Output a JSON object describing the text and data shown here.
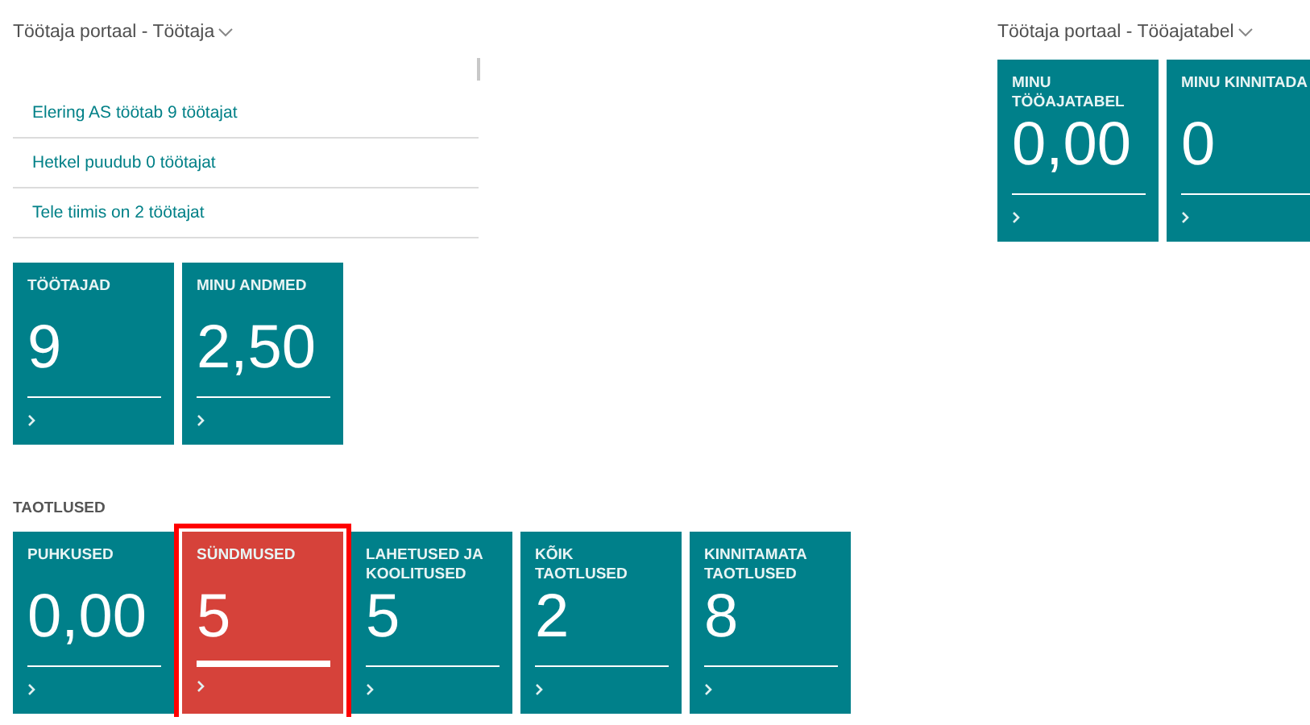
{
  "left_panel": {
    "title": "Töötaja portaal - Töötaja",
    "links": [
      "Elering AS töötab 9 töötajat",
      "Hetkel puudub 0 töötajat",
      "Tele tiimis on 2 töötajat"
    ],
    "tiles": [
      {
        "label": "TÖÖTAJAD",
        "value": "9",
        "selected": false
      },
      {
        "label": "MINU ANDMED",
        "value": "2,50",
        "selected": false
      }
    ],
    "section": {
      "title": "TAOTLUSED",
      "tiles": [
        {
          "label": "PUHKUSED",
          "value": "0,00",
          "selected": false
        },
        {
          "label": "SÜNDMUSED",
          "value": "5",
          "selected": true
        },
        {
          "label": "LAHETUSED JA KOOLITUSED",
          "value": "5",
          "selected": false
        },
        {
          "label": "KÕIK TAOTLUSED",
          "value": "2",
          "selected": false
        },
        {
          "label": "KINNITAMATA TAOTLUSED",
          "value": "8",
          "selected": false
        }
      ]
    }
  },
  "right_panel": {
    "title": "Töötaja portaal - Tööajatabel",
    "tiles": [
      {
        "label": "MINU TÖÖAJATABEL",
        "value": "0,00",
        "selected": false
      },
      {
        "label": "MINU KINNITADA",
        "value": "0",
        "selected": false
      }
    ]
  }
}
